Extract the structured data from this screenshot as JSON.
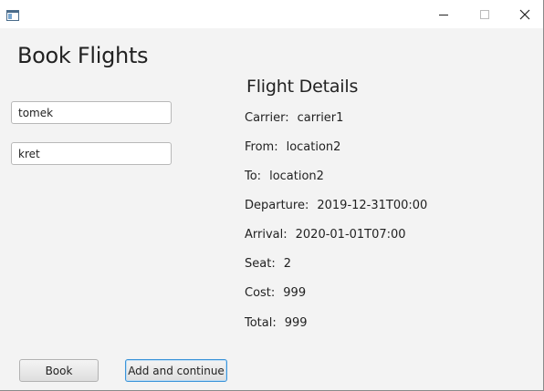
{
  "window": {
    "title": ""
  },
  "page": {
    "heading": "Book Flights"
  },
  "form": {
    "first_field_value": "tomek",
    "second_field_value": "kret"
  },
  "details": {
    "title": "Flight Details",
    "rows": [
      {
        "label": "Carrier:",
        "value": "carrier1"
      },
      {
        "label": "From:",
        "value": "location2"
      },
      {
        "label": "To:",
        "value": "location2"
      },
      {
        "label": "Departure:",
        "value": "2019-12-31T00:00"
      },
      {
        "label": "Arrival:",
        "value": "2020-01-01T07:00"
      },
      {
        "label": "Seat:",
        "value": "2"
      },
      {
        "label": "Cost:",
        "value": "999"
      },
      {
        "label": "Total:",
        "value": "999"
      }
    ]
  },
  "buttons": {
    "book_label": "Book",
    "add_continue_label": "Add and continue"
  },
  "colors": {
    "background": "#f3f3f3",
    "focus_border": "#3b94d9"
  }
}
